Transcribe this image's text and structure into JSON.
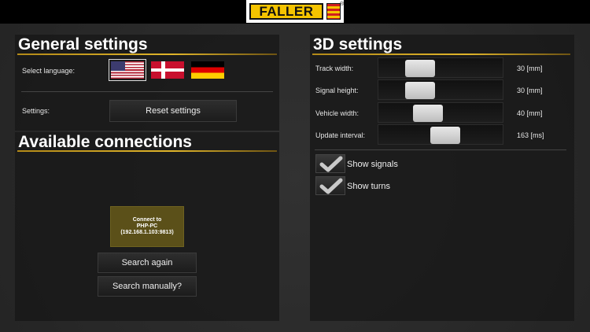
{
  "header": {
    "logo_text": "FALLER",
    "reg_mark": "®"
  },
  "general": {
    "title": "General settings",
    "language_label": "Select language:",
    "languages": [
      {
        "name": "english",
        "selected": true
      },
      {
        "name": "danish",
        "selected": false
      },
      {
        "name": "german",
        "selected": false
      }
    ],
    "settings_label": "Settings:",
    "reset_label": "Reset settings"
  },
  "connections": {
    "title": "Available connections",
    "connect_line1": "Connect to",
    "connect_line2": "PHP-PC",
    "connect_line3": "(192.168.1.103:9813)",
    "search_again": "Search again",
    "search_manually": "Search manually?"
  },
  "settings3d": {
    "title": "3D settings",
    "sliders": [
      {
        "label": "Track width:",
        "value": "30 [mm]",
        "level": 0.28
      },
      {
        "label": "Signal height:",
        "value": "30 [mm]",
        "level": 0.28
      },
      {
        "label": "Vehicle width:",
        "value": "40 [mm]",
        "level": 0.37
      },
      {
        "label": "Update interval:",
        "value": "163 [ms]",
        "level": 0.55
      }
    ],
    "show_signals": "Show signals",
    "show_turns": "Show turns"
  },
  "colors": {
    "accent": "#e0b52a",
    "connect_bg": "#5b5019"
  }
}
